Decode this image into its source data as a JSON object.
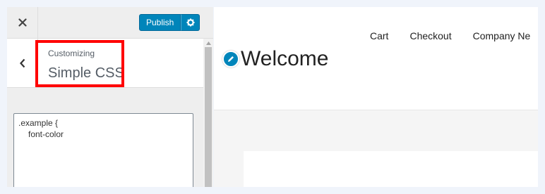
{
  "panel": {
    "publish_label": "Publish",
    "back_icon": "chevron-left-icon",
    "close_icon": "close-icon",
    "settings_icon": "gear-icon",
    "section_small": "Customizing",
    "section_title": "Simple CSS",
    "code_line1": ".example {",
    "code_line2": "font-color"
  },
  "preview": {
    "site_title": "Welcome",
    "edit_icon": "pencil-icon",
    "nav": [
      "Cart",
      "Checkout",
      "Company Ne"
    ]
  },
  "colors": {
    "accent": "#0085ba",
    "highlight": "#ff0000"
  }
}
